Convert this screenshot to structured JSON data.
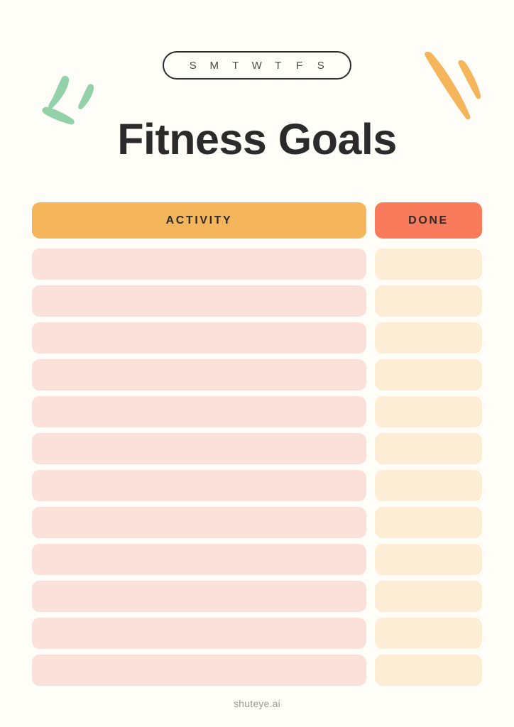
{
  "page": {
    "background_color": "#FFFDF7",
    "title": "Fitness Goals",
    "footer": "shuteye.ai"
  },
  "daybar": {
    "days": [
      "S",
      "M",
      "T",
      "W",
      "T",
      "F",
      "S"
    ],
    "border_color": "#2E2E2E"
  },
  "decorations": {
    "leaves": {
      "name": "green-leaves-decoration",
      "color": "#93D1A8"
    },
    "swoosh": {
      "name": "orange-swoosh-decoration",
      "color": "#F5B65B"
    }
  },
  "table": {
    "headers": [
      {
        "label": "ACTIVITY",
        "color": "#F5B65B"
      },
      {
        "label": "DONE",
        "color": "#F97B5C"
      }
    ],
    "row_count": 12,
    "activity_row_color": "#FCE0DA",
    "done_row_color": "#FDEDD4",
    "rows": [
      {
        "activity": "",
        "done": ""
      },
      {
        "activity": "",
        "done": ""
      },
      {
        "activity": "",
        "done": ""
      },
      {
        "activity": "",
        "done": ""
      },
      {
        "activity": "",
        "done": ""
      },
      {
        "activity": "",
        "done": ""
      },
      {
        "activity": "",
        "done": ""
      },
      {
        "activity": "",
        "done": ""
      },
      {
        "activity": "",
        "done": ""
      },
      {
        "activity": "",
        "done": ""
      },
      {
        "activity": "",
        "done": ""
      },
      {
        "activity": "",
        "done": ""
      }
    ]
  }
}
